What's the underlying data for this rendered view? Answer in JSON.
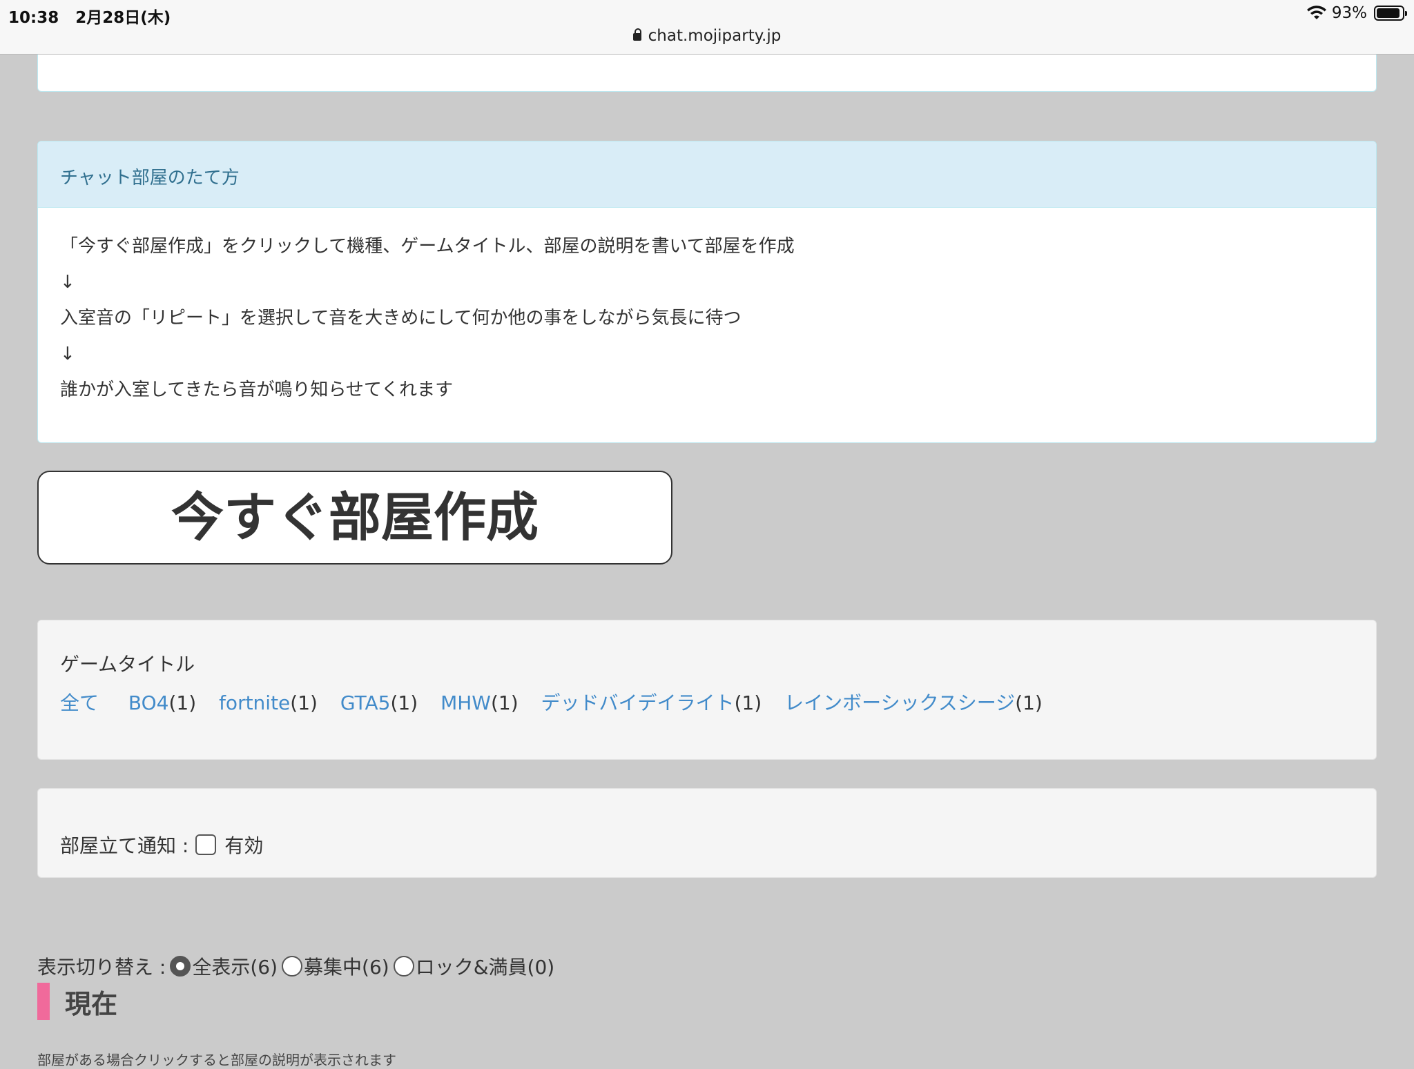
{
  "status_bar": {
    "time": "10:38",
    "date": "2月28日(木)",
    "url": "chat.mojiparty.jp",
    "battery": "93%",
    "battery_level": 0.93
  },
  "info": {
    "title": "チャット部屋のたて方",
    "lines": [
      "「今すぐ部屋作成」をクリックして機種、ゲームタイトル、部屋の説明を書いて部屋を作成",
      "↓",
      "入室音の「リピート」を選択して音を大きめにして何か他の事をしながら気長に待つ",
      "↓",
      "誰かが入室してきたら音が鳴り知らせてくれます"
    ]
  },
  "create_button": "今すぐ部屋作成",
  "games": {
    "title": "ゲームタイトル",
    "all_label": "全て",
    "items": [
      {
        "name": "BO4",
        "count": "(1)"
      },
      {
        "name": "fortnite",
        "count": "(1)"
      },
      {
        "name": "GTA5",
        "count": "(1)"
      },
      {
        "name": "MHW",
        "count": "(1)"
      },
      {
        "name": "デッドバイデイライト",
        "count": "(1)"
      },
      {
        "name": "レインボーシックスシージ",
        "count": "(1)"
      }
    ]
  },
  "notify": {
    "label": "部屋立て通知 :",
    "option": "有効"
  },
  "view_switch": {
    "label": "表示切り替え :",
    "options": [
      {
        "label": "全表示(6)",
        "selected": true
      },
      {
        "label": "募集中(6)",
        "selected": false
      },
      {
        "label": "ロック&満員(0)",
        "selected": false
      }
    ]
  },
  "section": {
    "title": "現在",
    "hint": "部屋がある場合クリックすると部屋の説明が表示されます"
  },
  "colors": {
    "link": "#428bca",
    "panel_heading": "#d9edf7",
    "section_bar": "#f06a9b"
  }
}
